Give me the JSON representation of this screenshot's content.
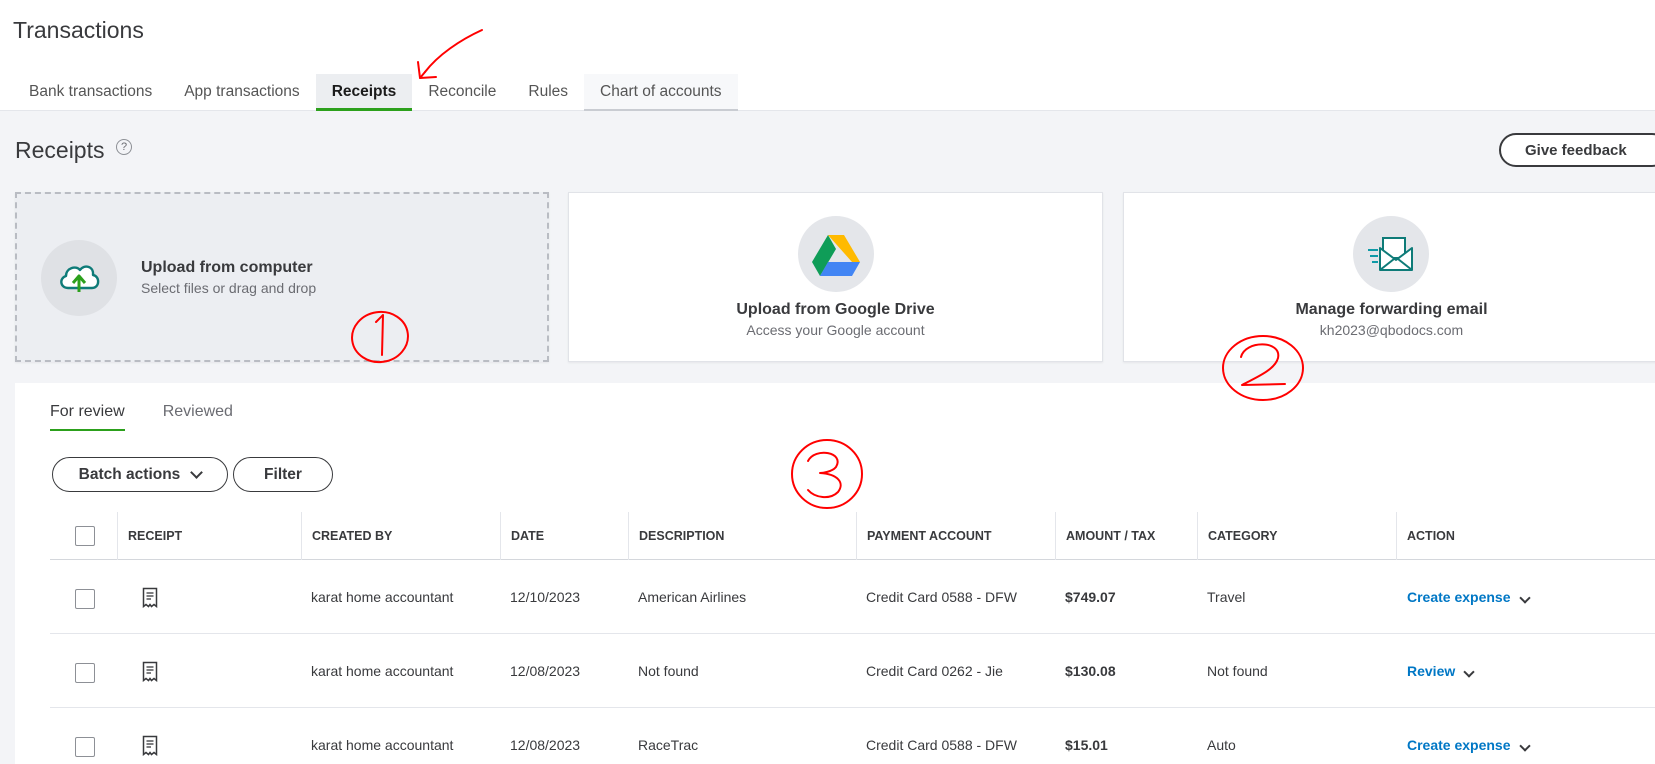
{
  "page": {
    "title": "Transactions"
  },
  "tabs": [
    "Bank transactions",
    "App transactions",
    "Receipts",
    "Reconcile",
    "Rules",
    "Chart of accounts"
  ],
  "section": {
    "title": "Receipts",
    "help_glyph": "?",
    "feedback_label": "Give feedback"
  },
  "cards": {
    "upload": {
      "title": "Upload from computer",
      "subtitle": "Select files or drag and drop"
    },
    "drive": {
      "title": "Upload from Google Drive",
      "subtitle": "Access your Google account"
    },
    "email": {
      "title": "Manage forwarding email",
      "subtitle": "kh2023@qbodocs.com"
    }
  },
  "review_tabs": [
    "For review",
    "Reviewed"
  ],
  "buttons": {
    "batch": "Batch actions",
    "filter": "Filter"
  },
  "table": {
    "headers": [
      "RECEIPT",
      "CREATED BY",
      "DATE",
      "DESCRIPTION",
      "PAYMENT ACCOUNT",
      "AMOUNT / TAX",
      "CATEGORY",
      "ACTION"
    ],
    "rows": [
      {
        "created_by": "karat home accountant",
        "date": "12/10/2023",
        "description": "American Airlines",
        "payment_account": "Credit Card 0588 - DFW",
        "amount": "$749.07",
        "category": "Travel",
        "action": "Create expense"
      },
      {
        "created_by": "karat home accountant",
        "date": "12/08/2023",
        "description": "Not found",
        "payment_account": "Credit Card 0262 - Jie",
        "amount": "$130.08",
        "category": "Not found",
        "action": "Review"
      },
      {
        "created_by": "karat home accountant",
        "date": "12/08/2023",
        "description": "RaceTrac",
        "payment_account": "Credit Card 0588 - DFW",
        "amount": "$15.01",
        "category": "Auto",
        "action": "Create expense"
      }
    ]
  },
  "colors": {
    "accent_green": "#2ca01c",
    "link_blue": "#0077c5",
    "annotation_red": "#ff0000"
  }
}
